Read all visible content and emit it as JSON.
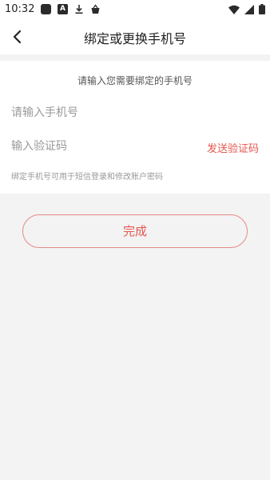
{
  "status_bar": {
    "time": "10:32",
    "a_icon_letter": "A"
  },
  "header": {
    "title": "绑定或更换手机号"
  },
  "form": {
    "prompt": "请输入您需要绑定的手机号",
    "phone_placeholder": "请输入手机号",
    "code_placeholder": "输入验证码",
    "send_code_label": "发送验证码",
    "hint": "绑定手机号可用于短信登录和修改账户密码"
  },
  "actions": {
    "done_label": "完成"
  },
  "colors": {
    "accent": "#e4574f",
    "button_border": "#e88a85",
    "background": "#f3f3f3"
  }
}
